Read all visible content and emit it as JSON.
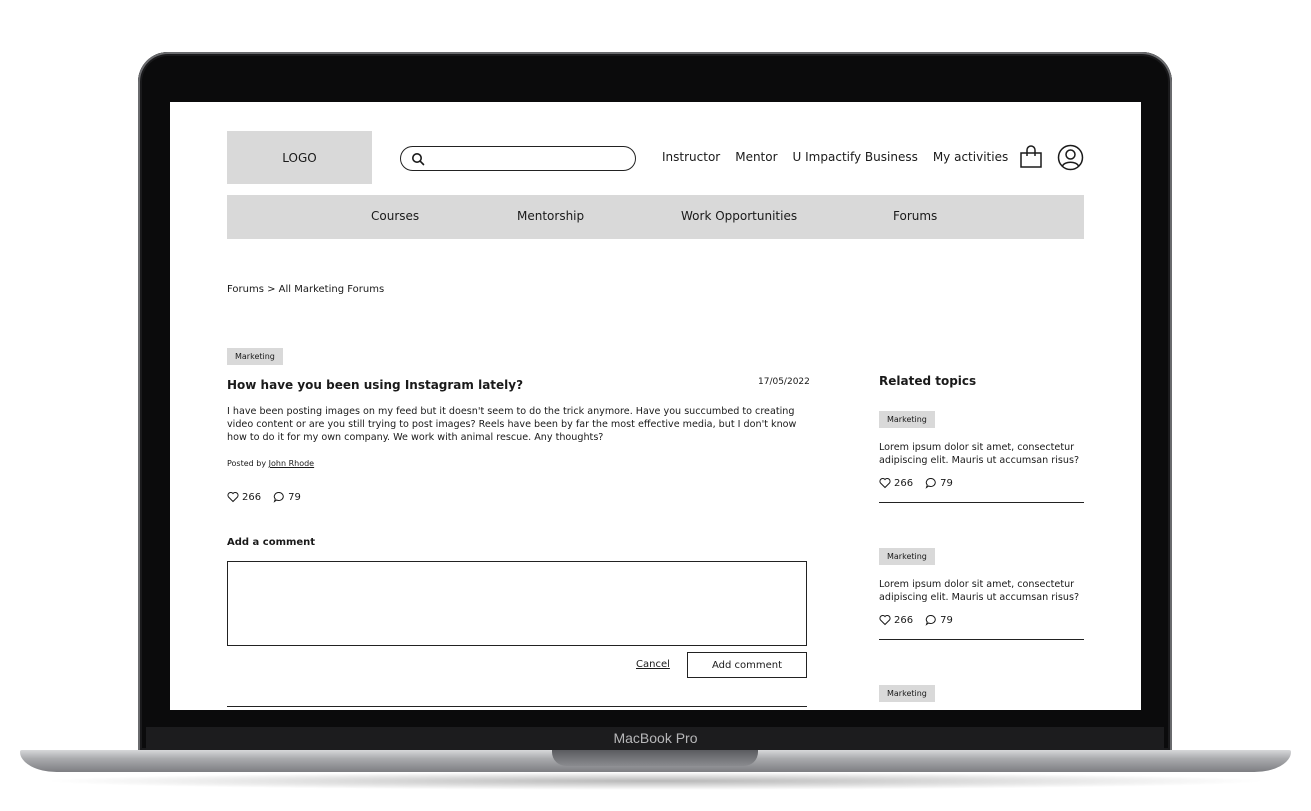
{
  "header": {
    "logo_text": "LOGO",
    "search": {
      "value": "",
      "placeholder": ""
    },
    "top_nav": [
      "Instructor",
      "Mentor",
      "U Impactify Business",
      "My activities"
    ]
  },
  "main_nav": [
    "Courses",
    "Mentorship",
    "Work Opportunities",
    "Forums"
  ],
  "breadcrumb": "Forums >  All Marketing Forums",
  "post": {
    "tag": "Marketing",
    "title": "How have you been using Instagram lately?",
    "date": "17/05/2022",
    "body": "I have been posting images on my feed but it doesn't seem to do the trick anymore. Have you succumbed to creating video content or are you still trying to post images? Reels have been by far the most effective media, but I don't know how to do it for my own company. We work with animal rescue. Any thoughts?",
    "posted_by_prefix": "Posted by ",
    "author": "John Rhode",
    "likes": "266",
    "comments": "79"
  },
  "comment_form": {
    "label": "Add a comment",
    "value": "",
    "cancel_label": "Cancel",
    "submit_label": "Add comment"
  },
  "related": {
    "title": "Related topics",
    "items": [
      {
        "tag": "Marketing",
        "text": "Lorem ipsum dolor sit amet, consectetur adipiscing elit. Mauris ut accumsan risus?",
        "likes": "266",
        "comments": "79"
      },
      {
        "tag": "Marketing",
        "text": "Lorem ipsum dolor sit amet, consectetur adipiscing elit. Mauris ut accumsan risus?",
        "likes": "266",
        "comments": "79"
      },
      {
        "tag": "Marketing"
      }
    ]
  },
  "device": {
    "label": "MacBook Pro"
  },
  "icons": {
    "search": "search-icon",
    "cart": "shopping-bag-icon",
    "user": "user-account-icon",
    "like": "heart-icon",
    "comment": "comment-bubble-icon"
  },
  "colors": {
    "placeholder_gray": "#d9d9d9",
    "ink": "#1a1a1a",
    "bezel": "#0b0b0c"
  }
}
